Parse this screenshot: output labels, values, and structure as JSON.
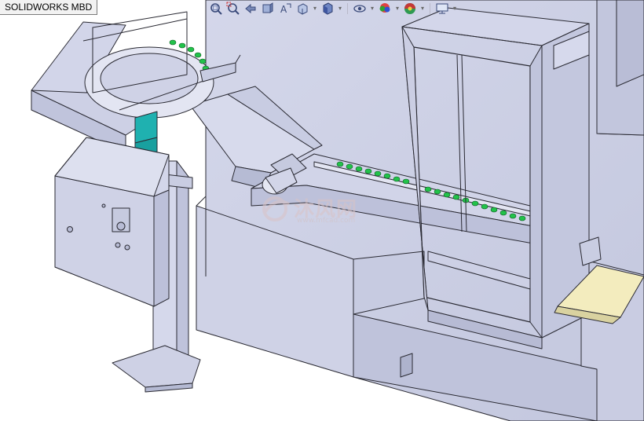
{
  "app": {
    "title": "SOLIDWORKS MBD"
  },
  "heads_up_toolbar": {
    "items": [
      {
        "icon": "zoom-to-fit-icon",
        "has_dropdown": false
      },
      {
        "icon": "zoom-to-area-icon",
        "has_dropdown": false
      },
      {
        "icon": "previous-view-icon",
        "has_dropdown": false
      },
      {
        "icon": "section-view-icon",
        "has_dropdown": false
      },
      {
        "icon": "dynamic-annotation-views-icon",
        "has_dropdown": false
      },
      {
        "icon": "view-orientation-icon",
        "has_dropdown": true
      },
      {
        "icon": "display-style-icon",
        "has_dropdown": true
      },
      {
        "icon": "hide-show-items-icon",
        "has_dropdown": true
      },
      {
        "icon": "edit-appearance-icon",
        "has_dropdown": true
      },
      {
        "icon": "apply-scene-icon",
        "has_dropdown": true
      },
      {
        "icon": "view-settings-icon",
        "has_dropdown": true
      }
    ]
  },
  "watermark": {
    "text": "沐风网",
    "subtext": "www.mfcad.com"
  },
  "colors": {
    "body": "#ccd0e4",
    "body_light": "#d9dcec",
    "body_dark": "#aeb3cd",
    "edge": "#2a2a33",
    "accent_green": "#22c24a",
    "accent_teal": "#1fb1b0",
    "tray_yellow": "#f3ecbe"
  }
}
